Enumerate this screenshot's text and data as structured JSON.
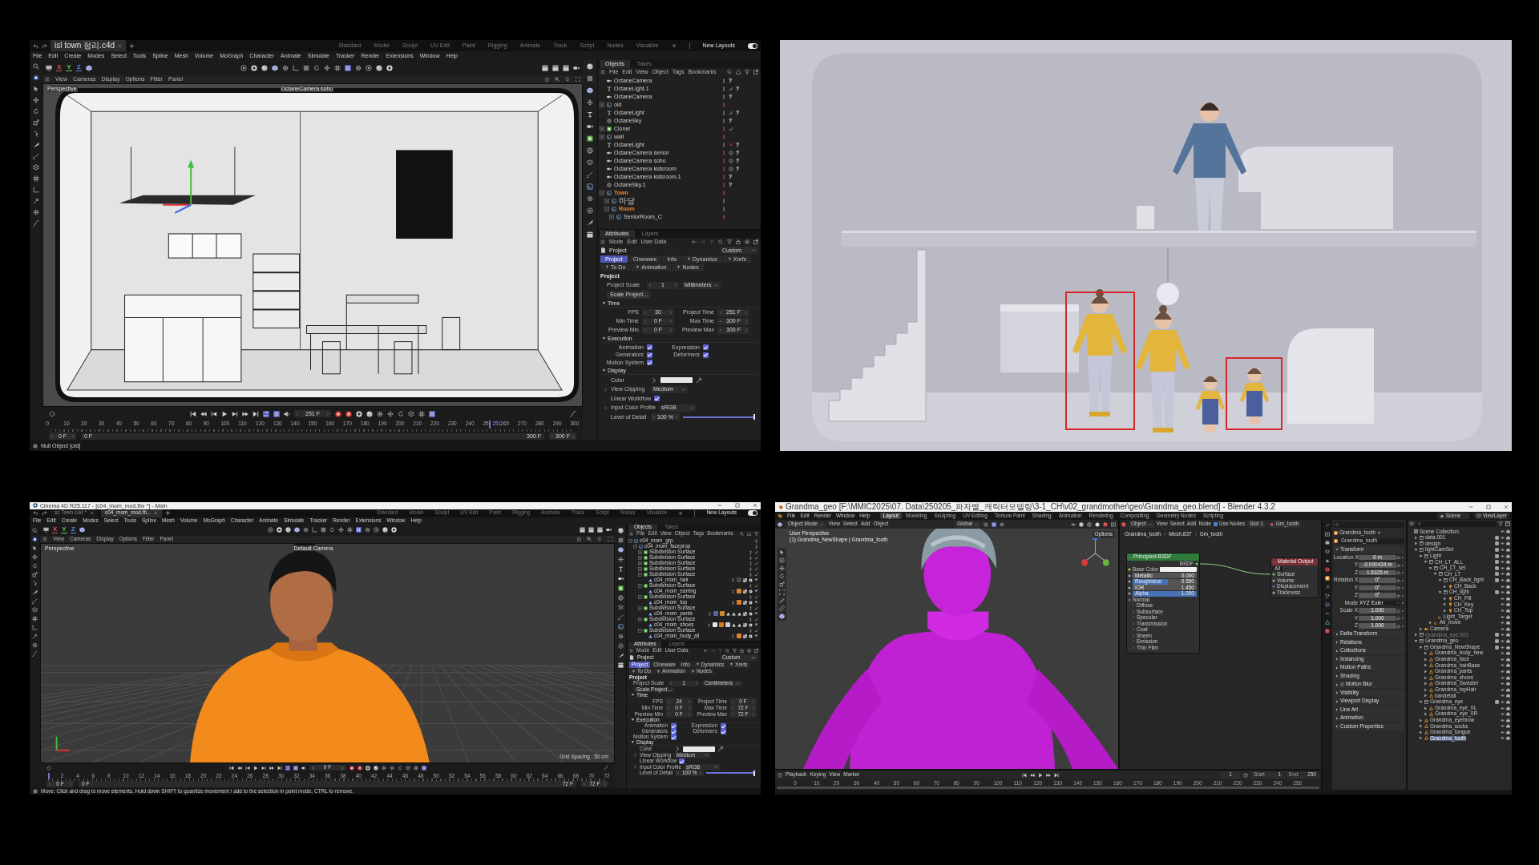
{
  "scene_window": {
    "file_tabs": [
      {
        "label": "isl town 정리.c4d",
        "selected": true
      }
    ],
    "layouts": [
      "Standard",
      "Model",
      "Sculpt",
      "UV Edit",
      "Paint",
      "Rigging",
      "Animate",
      "Track",
      "Script",
      "Nodes",
      "Visualize"
    ],
    "new_layouts": {
      "label": "New Layouts",
      "on": true
    },
    "menu": [
      "File",
      "Edit",
      "Create",
      "Modes",
      "Select",
      "Tools",
      "Spline",
      "Mesh",
      "Volume",
      "MoGraph",
      "Character",
      "Animate",
      "Simulate",
      "Tracker",
      "Render",
      "Extensions",
      "Window",
      "Help"
    ],
    "axis_toggles": [
      {
        "label": "X",
        "color": "#e0524c"
      },
      {
        "label": "Y",
        "color": "#73c24f"
      },
      {
        "label": "Z",
        "color": "#5b8fe8"
      }
    ],
    "viewport_menu": [
      "View",
      "Cameras",
      "Display",
      "Options",
      "Filter",
      "Panel"
    ],
    "viewport_name": "Perspective",
    "camera_name": "OctaneCamera soho",
    "objects": {
      "tabs": [
        {
          "label": "Objects",
          "selected": true
        },
        {
          "label": "Takes",
          "selected": false
        }
      ],
      "menu": [
        "File",
        "Edit",
        "View",
        "Object",
        "Tags",
        "Bookmarks"
      ],
      "items": [
        {
          "name": "OctaneCamera",
          "kind": "camera",
          "hidden": false,
          "tag": "?"
        },
        {
          "name": "OctaneLight.1",
          "kind": "light",
          "hidden": false,
          "enabled": true,
          "tag": "?"
        },
        {
          "name": "OctaneCamera",
          "kind": "camera",
          "hidden": false,
          "tag": "?"
        },
        {
          "name": "old",
          "kind": "null",
          "expanded": false,
          "hidden": true
        },
        {
          "name": "OctaneLight",
          "kind": "light",
          "hidden": false,
          "enabled": true,
          "tag": "?"
        },
        {
          "name": "OctaneSky",
          "kind": "sky",
          "hidden": false,
          "tag": "?"
        },
        {
          "name": "Cloner",
          "kind": "cloner",
          "expanded": false,
          "hidden": true,
          "enabled": true
        },
        {
          "name": "wall",
          "kind": "null",
          "expanded": false,
          "hidden": true
        },
        {
          "name": "OctaneLight",
          "kind": "light",
          "hidden": false,
          "enabled": false,
          "tag": "?"
        },
        {
          "name": "OctaneCamera senior",
          "kind": "camera",
          "hidden": true,
          "blocked": true,
          "tag": "?"
        },
        {
          "name": "OctaneCamera soho",
          "kind": "camera",
          "hidden": true,
          "blocked": true,
          "tag": "?"
        },
        {
          "name": "OctaneCamera kidsroom",
          "kind": "camera",
          "hidden": true,
          "blocked": true,
          "tag": "?"
        },
        {
          "name": "OctaneCamera kidsroom.1",
          "kind": "camera",
          "hidden": true,
          "tag": "?"
        },
        {
          "name": "OctaneSky.1",
          "kind": "sky",
          "hidden": true,
          "tag": "?"
        },
        {
          "name": "Town",
          "kind": "null",
          "expanded": true,
          "hidden": true,
          "color": "#e3892f",
          "children": [
            {
              "name": "마당",
              "kind": "null",
              "expanded": false,
              "hidden": false
            },
            {
              "name": "Room",
              "kind": "null",
              "expanded": true,
              "hidden": false,
              "color": "#e3892f",
              "children": [
                {
                  "name": "SeniorRoom_C",
                  "kind": "null",
                  "expanded": false,
                  "hidden": true
                }
              ]
            }
          ]
        }
      ]
    },
    "attributes": {
      "tabs": [
        {
          "label": "Attributes",
          "selected": true
        },
        {
          "label": "Layers",
          "selected": false
        }
      ],
      "menu": [
        "Mode",
        "Edit",
        "User Data"
      ],
      "title": "Project",
      "preset": "Custom",
      "sub_tabs": [
        {
          "label": "Project",
          "selected": true,
          "kind": "plain"
        },
        {
          "label": "Cineware",
          "selected": false,
          "kind": "plain"
        },
        {
          "label": "Info",
          "selected": false,
          "kind": "plain"
        },
        {
          "label": "Dynamics",
          "selected": false,
          "kind": "pinned"
        },
        {
          "label": "Xrefs",
          "selected": false,
          "kind": "pinned"
        },
        {
          "label": "To Do",
          "selected": false,
          "kind": "pinned"
        },
        {
          "label": "Animation",
          "selected": false,
          "kind": "pinned"
        },
        {
          "label": "Nodes",
          "selected": false,
          "kind": "pinned"
        }
      ],
      "heading": "Project",
      "scale": {
        "label": "Project Scale",
        "value": "1",
        "unit": "Millimeters"
      },
      "scale_button": "Scale Project...",
      "groups": [
        {
          "title": "Time",
          "fields": [
            {
              "label": "FPS",
              "value": "30"
            },
            {
              "label": "Project Time",
              "value": "251 F"
            },
            {
              "label": "Min Time",
              "value": "0 F"
            },
            {
              "label": "Max Time",
              "value": "300 F"
            },
            {
              "label": "Preview Min",
              "value": "0 F"
            },
            {
              "label": "Preview Max",
              "value": "300 F"
            }
          ]
        },
        {
          "title": "Execution",
          "checks": [
            {
              "label": "Animation",
              "checked": true
            },
            {
              "label": "Expression",
              "checked": true
            },
            {
              "label": "Generators",
              "checked": true
            },
            {
              "label": "Deformers",
              "checked": true
            },
            {
              "label": "Motion System",
              "checked": true
            }
          ]
        },
        {
          "title": "Display",
          "rows": [
            {
              "kind": "color",
              "label": "Color"
            },
            {
              "kind": "dropdown",
              "label": "View Clipping",
              "value": "Medium",
              "expanded": false
            },
            {
              "kind": "check",
              "label": "Linear Workflow",
              "checked": true
            },
            {
              "kind": "dropdown",
              "label": "Input Color Profile",
              "value": "sRGB",
              "expanded": false
            },
            {
              "kind": "slider",
              "label": "Level of Detail",
              "value": "100 %",
              "level": 1
            }
          ]
        }
      ]
    },
    "timeline": {
      "frame": "251 F",
      "ticks": [
        "0",
        "10",
        "20",
        "30",
        "40",
        "50",
        "60",
        "70",
        "80",
        "90",
        "100",
        "110",
        "120",
        "130",
        "140",
        "150",
        "160",
        "170",
        "180",
        "190",
        "200",
        "210",
        "220",
        "230",
        "240",
        "25",
        "260",
        "270",
        "280",
        "290",
        "300"
      ],
      "playhead": {
        "label": "251",
        "level": 0.837
      },
      "start": "0 F",
      "range_start": "0 F",
      "range_end": "300 F",
      "end": "300 F"
    },
    "status": "Null Object [old]"
  },
  "render": {
    "figures": [
      {
        "kind": "man",
        "highlighted": false
      },
      {
        "kind": "woman",
        "highlighted": true
      },
      {
        "kind": "woman",
        "highlighted": false
      },
      {
        "kind": "child",
        "highlighted": false
      },
      {
        "kind": "child",
        "highlighted": true
      }
    ]
  },
  "character_window": {
    "title": "Cinema 4D R25.117 - [c04_mom_mod.fbx *] - Main",
    "file_tabs": [
      {
        "label": "sc Town.c4d *",
        "selected": false
      },
      {
        "label": "c04_mom_mod.fb...",
        "selected": true
      }
    ],
    "layouts": [
      "Standard",
      "Model",
      "Sculpt",
      "UV Edit",
      "Paint",
      "Rigging",
      "Animate",
      "Track",
      "Script",
      "Nodes",
      "Visualize"
    ],
    "new_layouts": {
      "label": "New Layouts",
      "on": true
    },
    "menu": [
      "File",
      "Edit",
      "Create",
      "Modes",
      "Select",
      "Tools",
      "Spline",
      "Mesh",
      "Volume",
      "MoGraph",
      "Character",
      "Animate",
      "Simulate",
      "Tracker",
      "Render",
      "Extensions",
      "Window",
      "Help"
    ],
    "axis_toggles": [
      {
        "label": "X",
        "color": "#e0524c"
      },
      {
        "label": "Y",
        "color": "#73c24f"
      },
      {
        "label": "Z",
        "color": "#5b8fe8"
      }
    ],
    "viewport_menu": [
      "View",
      "Cameras",
      "Display",
      "Options",
      "Filter",
      "Panel"
    ],
    "viewport_name": "Perspective",
    "camera_name": "Default Camera",
    "grid_spacing": "Grid Spacing : 50 cm",
    "objects": {
      "tabs": [
        {
          "label": "Objects",
          "selected": true
        },
        {
          "label": "Takes",
          "selected": false
        }
      ],
      "menu": [
        "File",
        "Edit",
        "View",
        "Object",
        "Tags",
        "Bookmarks"
      ],
      "items": [
        {
          "name": "c04_mom_grp",
          "kind": "null",
          "expanded": true,
          "children": [
            {
              "name": "c04_mom_faceprop",
              "kind": "null",
              "expanded": true,
              "children": [
                {
                  "name": "Subdivision Surface",
                  "kind": "subdivision",
                  "expanded": false,
                  "enabled": true
                },
                {
                  "name": "Subdivision Surface",
                  "kind": "subdivision",
                  "expanded": false,
                  "enabled": true
                },
                {
                  "name": "Subdivision Surface",
                  "kind": "subdivision",
                  "expanded": false,
                  "enabled": true
                },
                {
                  "name": "Subdivision Surface",
                  "kind": "subdivision",
                  "expanded": false,
                  "enabled": true
                },
                {
                  "name": "Subdivision Surface",
                  "kind": "subdivision",
                  "expanded": true,
                  "enabled": true,
                  "children": [
                    {
                      "name": "c04_mom_hair",
                      "kind": "polygon",
                      "tags": [
                        {
                          "kind": "material",
                          "color": "#4a4a4a"
                        },
                        {
                          "kind": "uvw"
                        },
                        {
                          "kind": "phong"
                        },
                        {
                          "kind": "selection"
                        }
                      ]
                    }
                  ]
                },
                {
                  "name": "Subdivision Surface",
                  "kind": "subdivision",
                  "expanded": true,
                  "enabled": true,
                  "children": [
                    {
                      "name": "c04_mom_earring",
                      "kind": "polygon",
                      "tags": [
                        {
                          "kind": "material",
                          "color": "#d9822b"
                        },
                        {
                          "kind": "uvw"
                        },
                        {
                          "kind": "phong"
                        },
                        {
                          "kind": "selection"
                        }
                      ]
                    }
                  ]
                },
                {
                  "name": "Subdivision Surface",
                  "kind": "subdivision",
                  "expanded": true,
                  "enabled": true,
                  "children": [
                    {
                      "name": "c04_mom_top",
                      "kind": "polygon",
                      "tags": [
                        {
                          "kind": "material",
                          "color": "#e07b22"
                        },
                        {
                          "kind": "uvw"
                        },
                        {
                          "kind": "phong"
                        },
                        {
                          "kind": "selection"
                        }
                      ]
                    }
                  ]
                },
                {
                  "name": "Subdivision Surface",
                  "kind": "subdivision",
                  "expanded": true,
                  "enabled": true,
                  "children": [
                    {
                      "name": "c04_mom_pants",
                      "kind": "polygon",
                      "tags": [
                        {
                          "kind": "material",
                          "color": "#5a64a8"
                        },
                        {
                          "kind": "material",
                          "color": "#c98a2a"
                        },
                        {
                          "kind": "polygon_selection"
                        },
                        {
                          "kind": "polygon_selection"
                        },
                        {
                          "kind": "polygon_selection"
                        },
                        {
                          "kind": "uvw"
                        },
                        {
                          "kind": "phong"
                        },
                        {
                          "kind": "selection"
                        }
                      ]
                    }
                  ]
                },
                {
                  "name": "Subdivision Surface",
                  "kind": "subdivision",
                  "expanded": true,
                  "enabled": true,
                  "children": [
                    {
                      "name": "c04_mom_shoes",
                      "kind": "polygon",
                      "tags": [
                        {
                          "kind": "material",
                          "color": "#e6e6e6"
                        },
                        {
                          "kind": "material",
                          "color": "#d97a22"
                        },
                        {
                          "kind": "material",
                          "color": "#d0d0d0"
                        },
                        {
                          "kind": "polygon_selection"
                        },
                        {
                          "kind": "polygon_selection"
                        },
                        {
                          "kind": "uvw"
                        },
                        {
                          "kind": "phong"
                        },
                        {
                          "kind": "selection"
                        }
                      ]
                    }
                  ]
                },
                {
                  "name": "Subdivision Surface",
                  "kind": "subdivision",
                  "expanded": true,
                  "enabled": true,
                  "children": [
                    {
                      "name": "c04_mom_body_all",
                      "kind": "polygon",
                      "tags": [
                        {
                          "kind": "material",
                          "color": "#e08030"
                        },
                        {
                          "kind": "uvw"
                        },
                        {
                          "kind": "phong"
                        },
                        {
                          "kind": "selection"
                        }
                      ]
                    }
                  ]
                }
              ]
            }
          ]
        }
      ]
    },
    "attributes": {
      "tabs": [
        {
          "label": "Attributes",
          "selected": true
        },
        {
          "label": "Layers",
          "selected": false
        }
      ],
      "menu": [
        "Mode",
        "Edit",
        "User Data"
      ],
      "title": "Project",
      "preset": "Custom",
      "sub_tabs": [
        {
          "label": "Project",
          "selected": true,
          "kind": "plain"
        },
        {
          "label": "Cineware",
          "selected": false,
          "kind": "plain"
        },
        {
          "label": "Info",
          "selected": false,
          "kind": "plain"
        },
        {
          "label": "Dynamics",
          "selected": false,
          "kind": "pinned"
        },
        {
          "label": "Xrefs",
          "selected": false,
          "kind": "pinned"
        },
        {
          "label": "To Do",
          "selected": false,
          "kind": "pinned"
        },
        {
          "label": "Animation",
          "selected": false,
          "kind": "pinned"
        },
        {
          "label": "Nodes",
          "selected": false,
          "kind": "pinned"
        }
      ],
      "heading": "Project",
      "scale": {
        "label": "Project Scale",
        "value": "1",
        "unit": "Centimeters"
      },
      "scale_button": "Scale Project...",
      "groups": [
        {
          "title": "Time",
          "fields": [
            {
              "label": "FPS",
              "value": "24"
            },
            {
              "label": "Project Time",
              "value": "0 F"
            },
            {
              "label": "Min Time",
              "value": "0 F"
            },
            {
              "label": "Max Time",
              "value": "72 F"
            },
            {
              "label": "Preview Min",
              "value": "0 F"
            },
            {
              "label": "Preview Max",
              "value": "72 F"
            }
          ]
        },
        {
          "title": "Execution",
          "checks": [
            {
              "label": "Animation",
              "checked": true
            },
            {
              "label": "Expression",
              "checked": true
            },
            {
              "label": "Generators",
              "checked": true
            },
            {
              "label": "Deformers",
              "checked": true
            },
            {
              "label": "Motion System",
              "checked": true
            }
          ]
        },
        {
          "title": "Display",
          "rows": [
            {
              "kind": "color",
              "label": "Color"
            },
            {
              "kind": "dropdown",
              "label": "View Clipping",
              "value": "Medium",
              "expanded": false
            },
            {
              "kind": "check",
              "label": "Linear Workflow",
              "checked": true
            },
            {
              "kind": "dropdown",
              "label": "Input Color Profile",
              "value": "sRGB",
              "expanded": false
            },
            {
              "kind": "slider",
              "label": "Level of Detail",
              "value": "100 %",
              "level": 1
            }
          ]
        }
      ]
    },
    "timeline": {
      "frame": "0 F",
      "ticks": [
        "2",
        "4",
        "6",
        "8",
        "10",
        "12",
        "14",
        "16",
        "18",
        "20",
        "22",
        "24",
        "26",
        "28",
        "30",
        "32",
        "34",
        "36",
        "38",
        "40",
        "42",
        "44",
        "46",
        "48",
        "50",
        "52",
        "54",
        "56",
        "58",
        "60",
        "62",
        "64",
        "66",
        "68",
        "70",
        "72"
      ],
      "playhead": {
        "level": 0
      },
      "start": "0 F",
      "range_start": "0 F",
      "range_end": "72 F",
      "end": "72 F"
    },
    "status": "Move: Click and drag to move elements. Hold down SHIFT to quantize movement / add to the selection in point mode, CTRL to remove."
  },
  "blender_window": {
    "title": "Grandma_geo [F:\\MMIC2025\\07. Data\\250205_파자별_캐릭터모델링\\3-1_CH\\v02_grandmother\\geo\\Grandma_geo.blend] - Blender 4.3.2",
    "menu": [
      "File",
      "Edit",
      "Render",
      "Window",
      "Help"
    ],
    "workspaces": [
      {
        "label": "Layout",
        "selected": true
      },
      {
        "label": "Modeling",
        "selected": false
      },
      {
        "label": "Sculpting",
        "selected": false
      },
      {
        "label": "UV Editing",
        "selected": false
      },
      {
        "label": "Texture Paint",
        "selected": false
      },
      {
        "label": "Shading",
        "selected": false
      },
      {
        "label": "Animation",
        "selected": false
      },
      {
        "label": "Rendering",
        "selected": false
      },
      {
        "label": "Compositing",
        "selected": false
      },
      {
        "label": "Geometry Nodes",
        "selected": false
      },
      {
        "label": "Scripting",
        "selected": false
      }
    ],
    "scene": "Scene",
    "view_layer": "ViewLayer",
    "viewport": {
      "mode": "Object Mode",
      "menu": [
        "View",
        "Select",
        "Add",
        "Object"
      ],
      "orientation": "Global",
      "options": "Options",
      "info": [
        "User Perspective",
        "(1) Grandma_NewShape | Grandma_tooth"
      ]
    },
    "node_editor": {
      "object": "Object",
      "menu": [
        "View",
        "Select",
        "Add",
        "Node"
      ],
      "use_nodes": {
        "label": "Use Nodes",
        "checked": true
      },
      "slot": "Slot 1",
      "material": "Gm_tooth",
      "breadcrumbs": [
        "Grandma_tooth",
        "Mesh.837",
        "Gm_tooth"
      ],
      "bsdf": {
        "title": "Principled BSDF",
        "output": "BSDF",
        "base_color": "Base Color",
        "sliders": [
          {
            "label": "Metallic",
            "value": "0.000",
            "level": 0
          },
          {
            "label": "Roughness",
            "value": "0.550",
            "level": 0.55
          },
          {
            "label": "IOR",
            "value": "1.450",
            "level": 0
          },
          {
            "label": "Alpha",
            "value": "1.000",
            "level": 1
          }
        ],
        "normal": "Normal",
        "panels": [
          "Diffuse",
          "Subsurface",
          "Specular",
          "Transmission",
          "Coat",
          "Sheen",
          "Emission",
          "Thin Film"
        ]
      },
      "output": {
        "title": "Material Output",
        "target": "All",
        "inputs": [
          "Surface",
          "Volume",
          "Displacement",
          "Thickness"
        ]
      }
    },
    "timeline": {
      "menu": [
        "Playback",
        "Keying",
        "View",
        "Marker"
      ],
      "frame": "1",
      "start_label": "Start",
      "start": "1",
      "end_label": "End",
      "end": "250",
      "ticks": [
        "0",
        "10",
        "20",
        "30",
        "40",
        "50",
        "60",
        "70",
        "80",
        "90",
        "100",
        "110",
        "120",
        "130",
        "140",
        "150",
        "160",
        "170",
        "180",
        "190",
        "200",
        "210",
        "220",
        "230",
        "240",
        "250"
      ]
    },
    "properties": {
      "object": "Grandma_tooth",
      "name": "Grandma_tooth",
      "section": "Transform",
      "rows": [
        {
          "label": "Location X",
          "value": "0 m",
          "kind": "number"
        },
        {
          "label": "Y",
          "value": "-0.090434 m",
          "kind": "number"
        },
        {
          "label": "Z",
          "value": "1.5325 m",
          "kind": "number"
        },
        {
          "label": "Rotation X",
          "value": "0°",
          "kind": "number"
        },
        {
          "label": "Y",
          "value": "0°",
          "kind": "number"
        },
        {
          "label": "Z",
          "value": "0°",
          "kind": "number"
        },
        {
          "label": "Mode",
          "value": "XYZ Euler",
          "kind": "dropdown"
        },
        {
          "label": "Scale X",
          "value": "1.000",
          "kind": "number"
        },
        {
          "label": "Y",
          "value": "1.000",
          "kind": "number"
        },
        {
          "label": "Z",
          "value": "1.000",
          "kind": "number"
        }
      ],
      "panels": [
        {
          "label": "Delta Transform"
        },
        {
          "label": "Relations"
        },
        {
          "label": "Collections"
        },
        {
          "label": "Instancing"
        },
        {
          "label": "Motion Paths"
        },
        {
          "label": "Shading"
        },
        {
          "label": "Motion Blur",
          "checked": false
        },
        {
          "label": "Visibility"
        },
        {
          "label": "Viewport Display"
        },
        {
          "label": "Line Art"
        },
        {
          "label": "Animation"
        },
        {
          "label": "Custom Properties"
        }
      ]
    },
    "outliner": {
      "items": [
        {
          "name": "Scene Collection",
          "kind": "scene",
          "selected": false,
          "disabled": false,
          "children": [
            {
              "name": "data.001",
              "kind": "collection",
              "expanded": false,
              "selected": false,
              "disabled": false
            },
            {
              "name": "design",
              "kind": "collection",
              "expanded": false,
              "selected": false,
              "disabled": false
            },
            {
              "name": "lightCamSet",
              "kind": "collection",
              "expanded": true,
              "selected": false,
              "disabled": false,
              "children": [
                {
                  "name": "Light",
                  "kind": "collection",
                  "expanded": true,
                  "selected": false,
                  "disabled": false,
                  "children": [
                    {
                      "name": "CH_LT_ALL",
                      "kind": "collection",
                      "expanded": true,
                      "selected": false,
                      "disabled": false,
                      "children": [
                        {
                          "name": "CH_LT_set",
                          "kind": "collection",
                          "expanded": true,
                          "selected": false,
                          "disabled": false,
                          "children": [
                            {
                              "name": "CH_LT",
                              "kind": "collection",
                              "expanded": true,
                              "selected": false,
                              "disabled": false,
                              "children": [
                                {
                                  "name": "CH_Back_light",
                                  "kind": "collection",
                                  "expanded": true,
                                  "selected": false,
                                  "disabled": false,
                                  "children": [
                                    {
                                      "name": "CH_Back",
                                      "kind": "light",
                                      "expanded": false,
                                      "selected": false,
                                      "disabled": false
                                    }
                                  ]
                                },
                                {
                                  "name": "CH_light",
                                  "kind": "collection",
                                  "expanded": true,
                                  "selected": false,
                                  "disabled": false,
                                  "children": [
                                    {
                                      "name": "CH_Fill",
                                      "kind": "light",
                                      "expanded": false,
                                      "selected": false,
                                      "disabled": false
                                    },
                                    {
                                      "name": "CH_Key",
                                      "kind": "light",
                                      "expanded": false,
                                      "selected": false,
                                      "disabled": false
                                    },
                                    {
                                      "name": "CH_Top",
                                      "kind": "light",
                                      "expanded": false,
                                      "selected": false,
                                      "disabled": false
                                    }
                                  ]
                                }
                              ]
                            },
                            {
                              "name": "Light_Target",
                              "kind": "empty",
                              "selected": false,
                              "disabled": false
                            }
                          ]
                        },
                        {
                          "name": "All_move",
                          "kind": "empty",
                          "expanded": false,
                          "selected": false,
                          "disabled": false
                        }
                      ]
                    }
                  ]
                },
                {
                  "name": "Camera",
                  "kind": "camera",
                  "expanded": false,
                  "selected": false,
                  "disabled": false
                }
              ]
            },
            {
              "name": "Grandma_eye.003",
              "kind": "collection",
              "expanded": false,
              "selected": false,
              "disabled": true
            },
            {
              "name": "Grandma_geo",
              "kind": "collection",
              "expanded": true,
              "selected": false,
              "disabled": false,
              "children": [
                {
                  "name": "Grandma_NewShape",
                  "kind": "collection",
                  "expanded": true,
                  "selected": false,
                  "disabled": false,
                  "children": [
                    {
                      "name": "Grandma_body_new",
                      "kind": "mesh",
                      "expanded": false,
                      "selected": false,
                      "disabled": false
                    },
                    {
                      "name": "Grandma_face",
                      "kind": "mesh",
                      "expanded": false,
                      "selected": false,
                      "disabled": false
                    },
                    {
                      "name": "Grandma_hairBase",
                      "kind": "mesh",
                      "expanded": false,
                      "selected": false,
                      "disabled": false
                    },
                    {
                      "name": "Grandma_pants",
                      "kind": "mesh",
                      "expanded": false,
                      "selected": false,
                      "disabled": false
                    },
                    {
                      "name": "Grandma_shoes",
                      "kind": "mesh",
                      "expanded": false,
                      "selected": false,
                      "disabled": false
                    },
                    {
                      "name": "Grandma_Sweater",
                      "kind": "mesh",
                      "expanded": false,
                      "selected": false,
                      "disabled": false
                    },
                    {
                      "name": "Grandma_topHair",
                      "kind": "mesh",
                      "expanded": false,
                      "selected": false,
                      "disabled": false
                    },
                    {
                      "name": "handetail",
                      "kind": "mesh",
                      "expanded": false,
                      "selected": false,
                      "disabled": false
                    }
                  ]
                },
                {
                  "name": "Grandma_eye",
                  "kind": "collection",
                  "expanded": true,
                  "selected": false,
                  "disabled": false,
                  "children": [
                    {
                      "name": "Grandma_eye_0L",
                      "kind": "mesh",
                      "expanded": false,
                      "selected": false,
                      "disabled": false
                    },
                    {
                      "name": "Grandma_eye_0R",
                      "kind": "mesh",
                      "expanded": false,
                      "selected": false,
                      "disabled": false
                    }
                  ]
                },
                {
                  "name": "Grandma_eyebrow",
                  "kind": "mesh",
                  "expanded": false,
                  "selected": false,
                  "disabled": false
                },
                {
                  "name": "Grandma_socks",
                  "kind": "mesh",
                  "expanded": false,
                  "selected": false,
                  "disabled": false
                },
                {
                  "name": "Grandma_tongue",
                  "kind": "mesh",
                  "expanded": false,
                  "selected": false,
                  "disabled": false
                },
                {
                  "name": "Grandma_tooth",
                  "kind": "mesh",
                  "expanded": false,
                  "selected": true,
                  "disabled": false
                }
              ]
            }
          ]
        }
      ]
    }
  }
}
